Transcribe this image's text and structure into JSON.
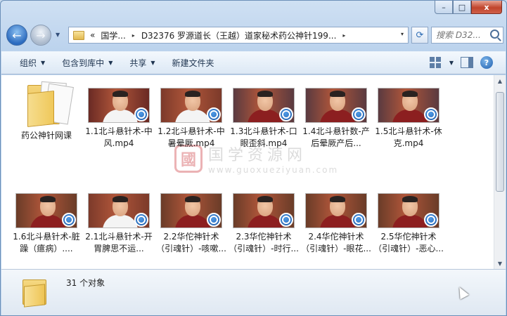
{
  "window": {
    "caption_buttons": {
      "minimize": "–",
      "maximize": "□",
      "close": "x"
    }
  },
  "nav": {
    "back_icon": "←",
    "forward_icon": "→",
    "history_dropdown": "▼"
  },
  "address_bar": {
    "overflow": "«",
    "segments": [
      "国学...",
      "D32376 罗源道长（王越）道家秘术药公神针199..."
    ],
    "separator": "▸",
    "dropdown": "▾"
  },
  "refresh_icon": "⟳",
  "search": {
    "placeholder": "搜索 D32..."
  },
  "toolbar": {
    "organize": "组织",
    "include_in_library": "包含到库中",
    "share": "共享",
    "new_folder": "新建文件夹",
    "caret": "▼",
    "help": "?"
  },
  "files": [
    {
      "name": "药公神针网课",
      "type": "folder"
    },
    {
      "name": "1.1北斗悬针术-中风.mp4",
      "type": "video",
      "body_color": "#f4f4f4",
      "bg_color": "#6a2a24"
    },
    {
      "name": "1.2北斗悬针术-中暑晕厥.mp4",
      "type": "video",
      "body_color": "#f4f4f4",
      "bg_color": "#7c3a2a"
    },
    {
      "name": "1.3北斗悬针术-口眼歪斜.mp4",
      "type": "video",
      "body_color": "#8c1f20",
      "bg_color": "#5a3a40"
    },
    {
      "name": "1.4北斗悬针数-产后晕厥产后...",
      "type": "video",
      "body_color": "#8c1f20",
      "bg_color": "#5a3a40"
    },
    {
      "name": "1.5北斗悬针术-休克.mp4",
      "type": "video",
      "body_color": "#8c1f20",
      "bg_color": "#5a3a40"
    },
    {
      "name": "1.6北斗悬针术-脏躁（癔病）....",
      "type": "video",
      "body_color": "#8c1f20",
      "bg_color": "#6a3c28"
    },
    {
      "name": "2.1北斗悬针术-开胃脾思不运...",
      "type": "video",
      "body_color": "#f4f4f4",
      "bg_color": "#7c3a2a"
    },
    {
      "name": "2.2华佗神针术（引魂针）-咳嗽...",
      "type": "video",
      "body_color": "#8c1f20",
      "bg_color": "#6a3c28"
    },
    {
      "name": "2.3华佗神针术（引魂针）-时行...",
      "type": "video",
      "body_color": "#8c1f20",
      "bg_color": "#6a3c28"
    },
    {
      "name": "2.4华佗神针术（引魂针）-眼花...",
      "type": "video",
      "body_color": "#8c1f20",
      "bg_color": "#6a3c28"
    },
    {
      "name": "2.5华佗神针术（引魂针）-恶心...",
      "type": "video",
      "body_color": "#8c1f20",
      "bg_color": "#6a3c28"
    }
  ],
  "watermark": {
    "logo": "國",
    "chinese": "国学资源网",
    "url": "www.guoxueziyuan.com"
  },
  "details": {
    "count": "31 个对象"
  },
  "colors": {
    "accent": "#2c6bbf",
    "close": "#c0452c",
    "folder": "#efc85a"
  }
}
